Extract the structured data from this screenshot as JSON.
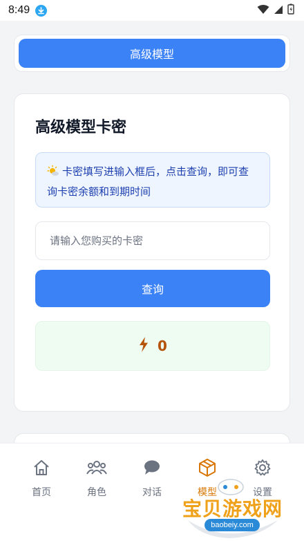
{
  "status_bar": {
    "time": "8:49"
  },
  "top": {
    "button_label": "高级模型"
  },
  "card": {
    "title": "高级模型卡密",
    "notice": "卡密填写进输入框后，点击查询，即可查询卡密余额和到期时间",
    "input_placeholder": "请输入您购买的卡密",
    "query_label": "查询",
    "result_value": "0"
  },
  "nav": {
    "items": [
      {
        "label": "首页",
        "icon": "home-icon"
      },
      {
        "label": "角色",
        "icon": "users-icon"
      },
      {
        "label": "对话",
        "icon": "chat-icon"
      },
      {
        "label": "模型",
        "icon": "cube-icon",
        "active": true
      },
      {
        "label": "设置",
        "icon": "gear-icon"
      }
    ]
  },
  "watermark": {
    "title": "宝贝游戏网",
    "url": "baobeiy.com"
  },
  "colors": {
    "accent": "#3b82f6",
    "active_nav": "#d97706",
    "result_bg": "#effcf2"
  }
}
